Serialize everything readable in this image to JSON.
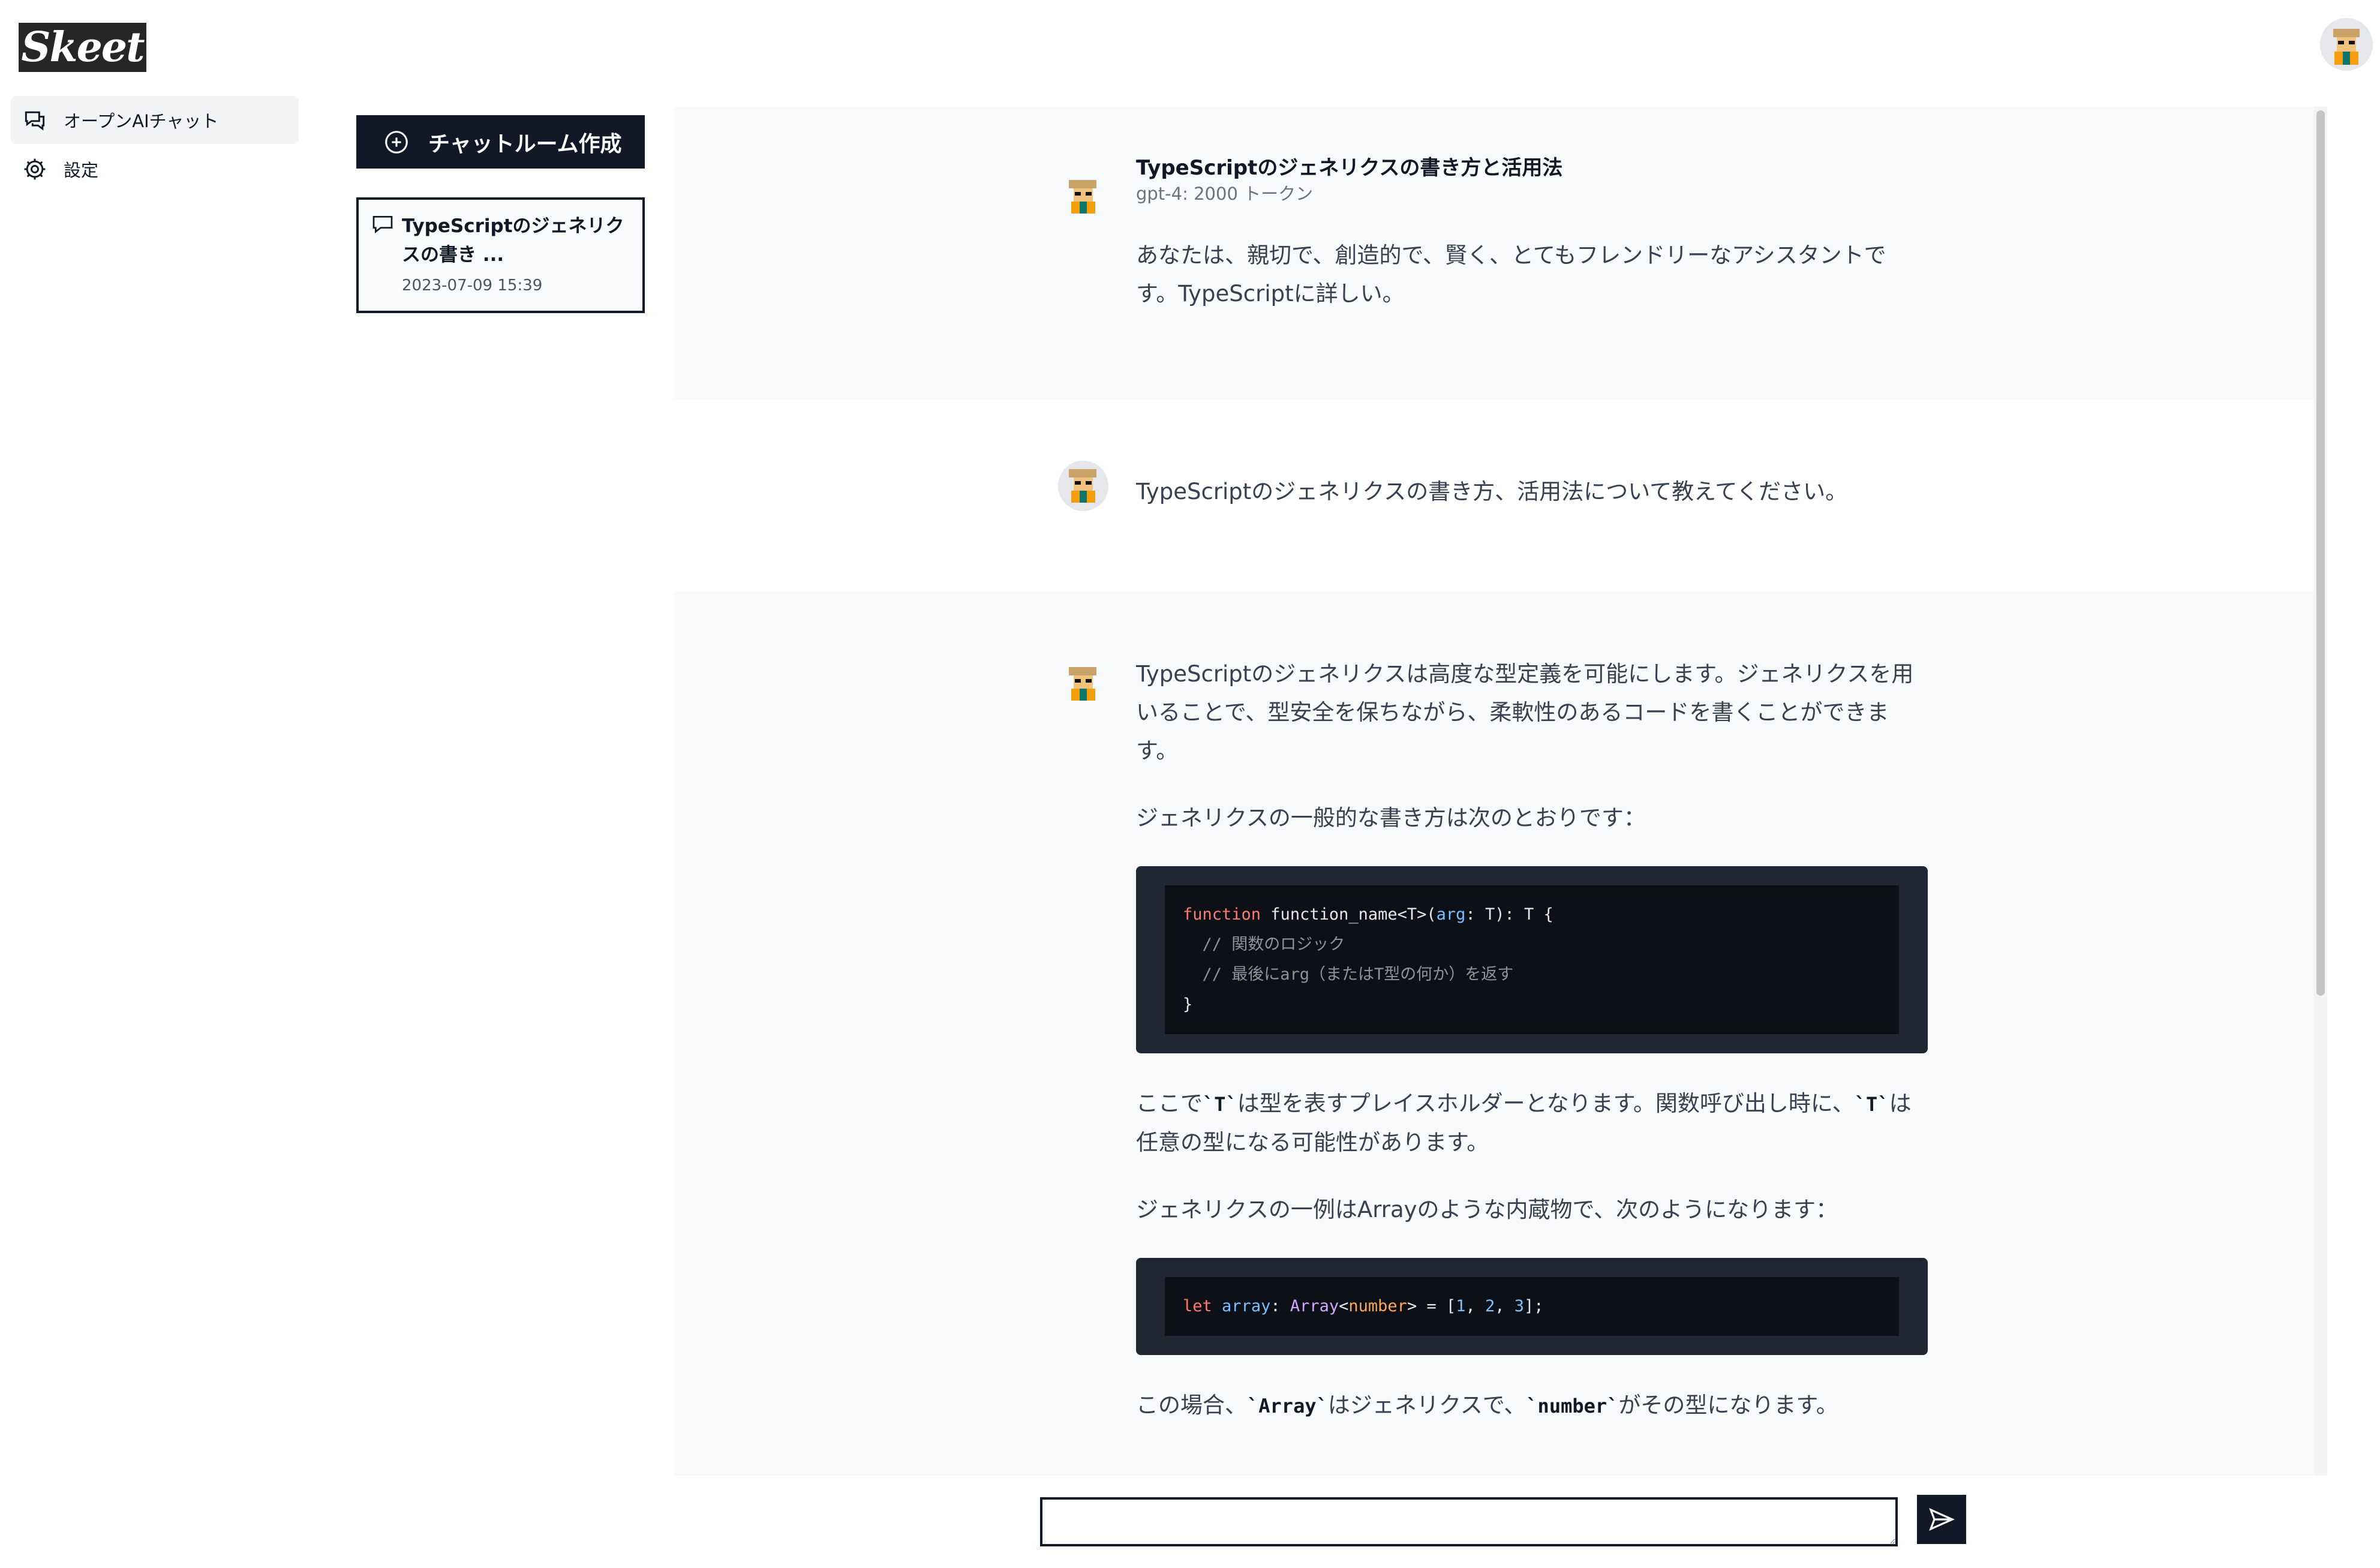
{
  "app": {
    "logo": "Skeet"
  },
  "nav": [
    {
      "label": "オープンAIチャット",
      "icon": "chat-bubbles-icon",
      "active": true
    },
    {
      "label": "設定",
      "icon": "gear-icon",
      "active": false
    }
  ],
  "rooms": {
    "create_label": "チャットルーム作成",
    "items": [
      {
        "title": "TypeScriptのジェネリクスの書き ...",
        "date": "2023-07-09 15:39"
      }
    ]
  },
  "chat": {
    "system": {
      "title": "TypeScriptのジェネリクスの書き方と活用法",
      "model": "gpt-4: 2000 トークン",
      "prompt": "あなたは、親切で、創造的で、賢く、とてもフレンドリーなアシスタントです。TypeScriptに詳しい。"
    },
    "user": {
      "text": "TypeScriptのジェネリクスの書き方、活用法について教えてください。"
    },
    "assistant": {
      "p1": "TypeScriptのジェネリクスは高度な型定義を可能にします。ジェネリクスを用いることで、型安全を保ちながら、柔軟性のあるコードを書くことができます。",
      "p2": "ジェネリクスの一般的な書き方は次のとおりです：",
      "code1": {
        "kw": "function",
        "sig": " function_name<T>(",
        "arg": "arg",
        "sig_end": ": T): T {",
        "c1": "  // 関数のロジック",
        "c2": "  // 最後にarg（またはT型の何か）を返す",
        "close": "}"
      },
      "p3_a": "ここで",
      "p3_code1": "`T`",
      "p3_b": "は型を表すプレイスホルダーとなります。関数呼び出し時に、",
      "p3_code2": "`T`",
      "p3_c": "は任意の型になる可能性があります。",
      "p4": "ジェネリクスの一例はArrayのような内蔵物で、次のようになります：",
      "code2": {
        "kw": "let",
        "name": "array",
        "type": "Array",
        "param": "number",
        "n1": "1",
        "n2": "2",
        "n3": "3"
      },
      "p5_a": "この場合、",
      "p5_code1": "`Array`",
      "p5_b": "はジェネリクスで、",
      "p5_code2": "`number`",
      "p5_c": "がその型になります。"
    }
  },
  "composer": {
    "value": "",
    "send_icon": "send-icon"
  }
}
